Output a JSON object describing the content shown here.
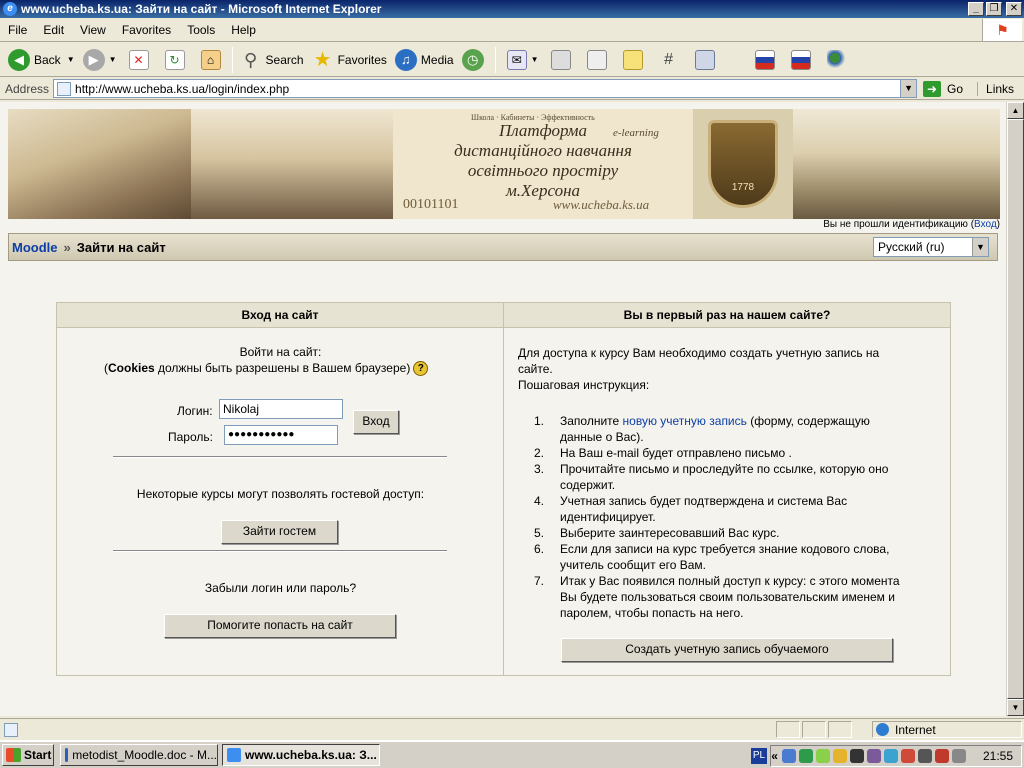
{
  "window": {
    "title": "www.ucheba.ks.ua: Зайти на сайт - Microsoft Internet Explorer",
    "buttons": [
      "_",
      "❐",
      "✕"
    ]
  },
  "menu": [
    "File",
    "Edit",
    "View",
    "Favorites",
    "Tools",
    "Help"
  ],
  "toolbar": {
    "back": "Back",
    "search": "Search",
    "favorites": "Favorites",
    "media": "Media"
  },
  "address": {
    "label": "Address",
    "url": "http://www.ucheba.ks.ua/login/index.php",
    "go": "Go",
    "links": "Links"
  },
  "banner": {
    "line1": "Платформа",
    "line2": "дистанційного навчання",
    "line3": "освітнього простіру",
    "line4": "м.Херсона",
    "code": "00101101",
    "url": "www.ucheba.ks.ua",
    "elearning": "e-learning",
    "year": "1778"
  },
  "login_info": {
    "prefix": "Вы не прошли идентификацию (",
    "link": "Вход",
    "suffix": ")"
  },
  "nav": {
    "home": "Moodle",
    "sep": "»",
    "current": "Зайти на сайт",
    "language": "Русский (ru)"
  },
  "login_box": {
    "header": "Вход на сайт",
    "intro": "Войти на сайт:",
    "cookies_bold": "Cookies",
    "cookies_rest": " должны быть разрешены в Вашем браузере)",
    "cookies_open": "(",
    "username_label": "Логин:",
    "username_value": "Nikolaj",
    "password_label": "Пароль:",
    "password_value": "●●●●●●●●●●●",
    "login_button": "Вход",
    "guest_text": "Некоторые курсы могут позволять гостевой доступ:",
    "guest_button": "Зайти гостем",
    "forgot_text": "Забыли логин или пароль?",
    "forgot_button": "Помогите попасть на сайт"
  },
  "signup_box": {
    "header": "Вы в первый раз на нашем сайте?",
    "intro1": "Для доступа к курсу Вам необходимо создать учетную запись на",
    "intro2": "сайте.",
    "intro3": "Пошаговая инструкция:",
    "steps": [
      {
        "n": "1.",
        "pre": "Заполните ",
        "link": "новую учетную запись",
        "post": " (форму, содержащую",
        "line2": "данные о Вас)."
      },
      {
        "n": "2.",
        "pre": "На Ваш e-mail будет отправлено письмо .",
        "link": "",
        "post": "",
        "line2": ""
      },
      {
        "n": "3.",
        "pre": "Прочитайте письмо и проследуйте по ссылке, которую оно",
        "link": "",
        "post": "",
        "line2": "содержит."
      },
      {
        "n": "4.",
        "pre": "Учетная запись будет подтверждена и система Вас",
        "link": "",
        "post": "",
        "line2": "идентифицирует."
      },
      {
        "n": "5.",
        "pre": "Выберите заинтересовавший Вас курс.",
        "link": "",
        "post": "",
        "line2": ""
      },
      {
        "n": "6.",
        "pre": "Если для записи на курс требуется знание кодового слова,",
        "link": "",
        "post": "",
        "line2": "учитель сообщит его Вам."
      },
      {
        "n": "7.",
        "pre": "Итак у Вас появился полный доступ к курсу: с этого момента",
        "link": "",
        "post": "",
        "line2": "Вы будете пользоваться своим пользовательским именем и",
        "line3": "паролем, чтобы попасть на него."
      }
    ],
    "create_button": "Создать учетную запись обучаемого"
  },
  "status": {
    "zone": "Internet"
  },
  "taskbar": {
    "start": "Start",
    "tasks": [
      "metodist_Moodle.doc - M...",
      "www.ucheba.ks.ua: З..."
    ],
    "lang": "PL",
    "clock": "21:55"
  },
  "colors": {
    "link": "#0b3fa6",
    "titlebar": "#0a246a"
  }
}
